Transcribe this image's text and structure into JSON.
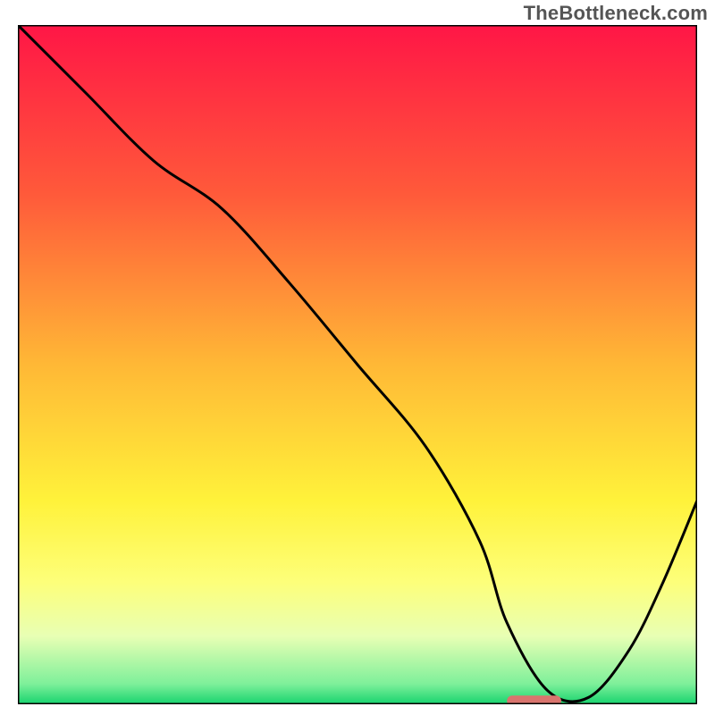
{
  "watermark": "TheBottleneck.com",
  "chart_data": {
    "type": "line",
    "title": "",
    "xlabel": "",
    "ylabel": "",
    "xlim": [
      0,
      100
    ],
    "ylim": [
      0,
      100
    ],
    "x": [
      0,
      10,
      20,
      30,
      40,
      50,
      60,
      68,
      72,
      78,
      84,
      90,
      95,
      100
    ],
    "values": [
      100,
      90,
      80,
      73,
      62,
      50,
      38,
      24,
      12,
      2,
      1,
      8,
      18,
      30
    ],
    "marker": {
      "x_range": [
        72,
        80
      ],
      "y": 0.5
    },
    "gradient_stops": [
      {
        "offset": 0.0,
        "color": "#ff1646"
      },
      {
        "offset": 0.25,
        "color": "#ff5a3a"
      },
      {
        "offset": 0.5,
        "color": "#ffb836"
      },
      {
        "offset": 0.7,
        "color": "#fff23a"
      },
      {
        "offset": 0.82,
        "color": "#fdff7a"
      },
      {
        "offset": 0.9,
        "color": "#e8ffb4"
      },
      {
        "offset": 0.97,
        "color": "#7ef09a"
      },
      {
        "offset": 1.0,
        "color": "#17d36e"
      }
    ],
    "curve_color": "#000000",
    "marker_color": "#d9746e",
    "frame_color": "#000000"
  }
}
